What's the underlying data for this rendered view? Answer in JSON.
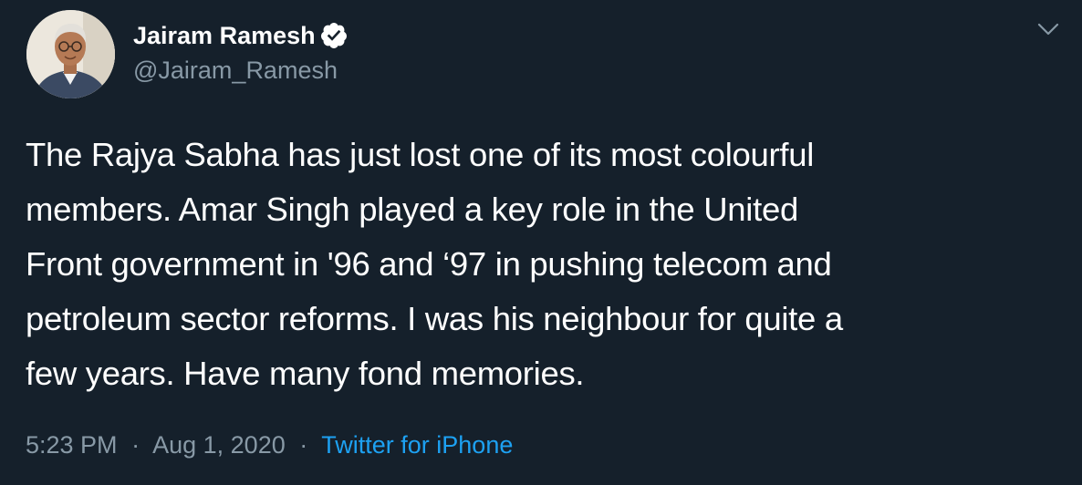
{
  "tweet": {
    "author": {
      "display_name": "Jairam Ramesh",
      "handle": "@Jairam_Ramesh",
      "verified_icon": "verified-badge-icon"
    },
    "text_lines": [
      "The Rajya Sabha has just lost one of its most colourful",
      "members. Amar Singh played a key role in the United",
      "Front government in '96 and ‘97 in pushing telecom and",
      "petroleum sector reforms. I was his neighbour for quite a",
      "few years. Have many fond memories."
    ],
    "meta": {
      "time": "5:23 PM",
      "separator": "·",
      "date": "Aug 1, 2020",
      "source": "Twitter for iPhone"
    },
    "menu_icon": "chevron-down-icon"
  },
  "colors": {
    "background": "#15202b",
    "text_primary": "#ffffff",
    "text_secondary": "#8899a6",
    "accent": "#1da1f2"
  }
}
